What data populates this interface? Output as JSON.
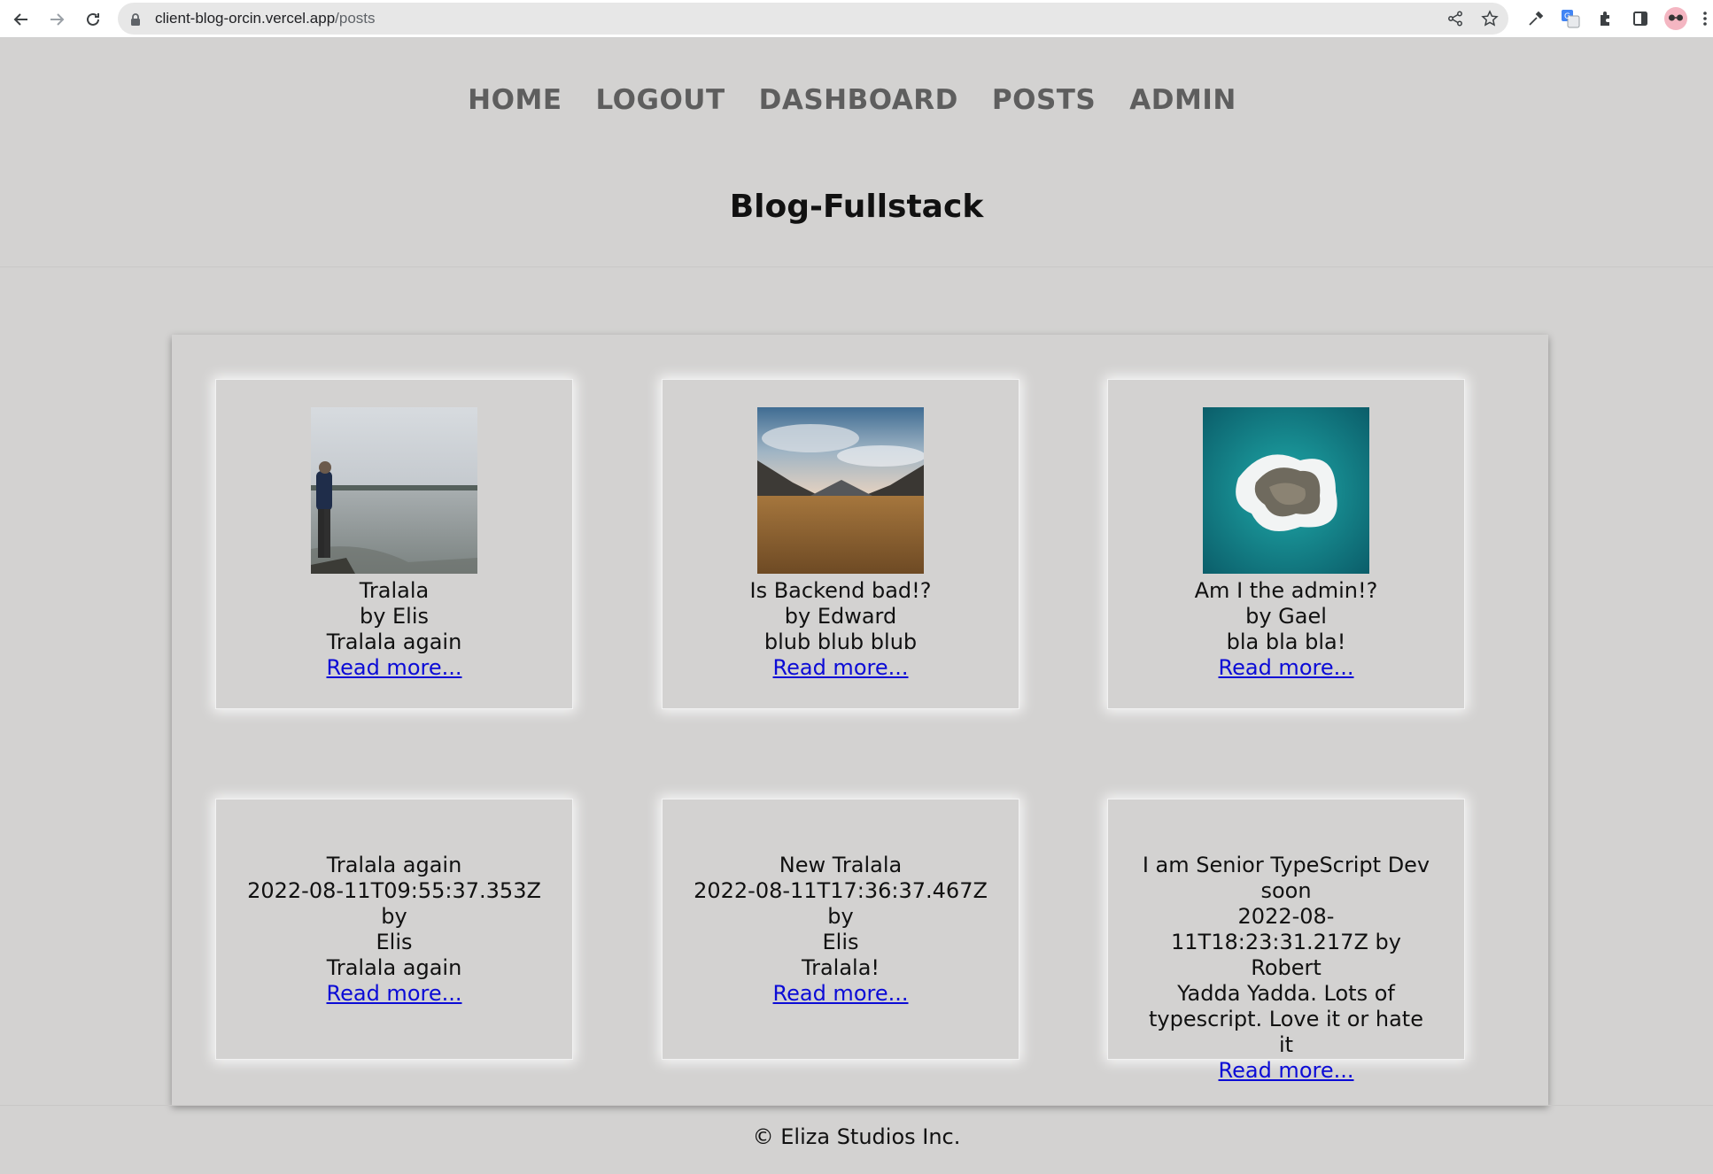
{
  "browser": {
    "url_host": "client-blog-orcin.vercel.app",
    "url_path": "/posts"
  },
  "nav": {
    "items": [
      {
        "label": "HOME"
      },
      {
        "label": "LOGOUT"
      },
      {
        "label": "DASHBOARD"
      },
      {
        "label": "POSTS"
      },
      {
        "label": "ADMIN"
      }
    ]
  },
  "site_title": "Blog-Fullstack",
  "posts": [
    {
      "title": "Tralala",
      "byline": "by Elis",
      "body": "Tralala again",
      "read_more": "Read more..."
    },
    {
      "title": "Is Backend bad!?",
      "byline": "by Edward",
      "body": "blub blub blub",
      "read_more": "Read more..."
    },
    {
      "title": "Am I the admin!?",
      "byline": "by Gael",
      "body": "bla bla bla!",
      "read_more": "Read more..."
    },
    {
      "title": "Tralala again",
      "date": "2022-08-11T09:55:37.353Z",
      "by": "by",
      "author": "Elis",
      "body": "Tralala again",
      "read_more": "Read more..."
    },
    {
      "title": "New Tralala",
      "date": "2022-08-11T17:36:37.467Z",
      "by": "by",
      "author": "Elis",
      "body": "Tralala!",
      "read_more": "Read more..."
    },
    {
      "title": "I am Senior TypeScript Dev soon",
      "date": "2022-08-11T18:23:31.217Z",
      "by": "by",
      "author": "Robert",
      "body": "Yadda Yadda. Lots of typescript. Love it or hate it",
      "read_more": "Read more..."
    }
  ],
  "footer": "© Eliza Studios Inc."
}
